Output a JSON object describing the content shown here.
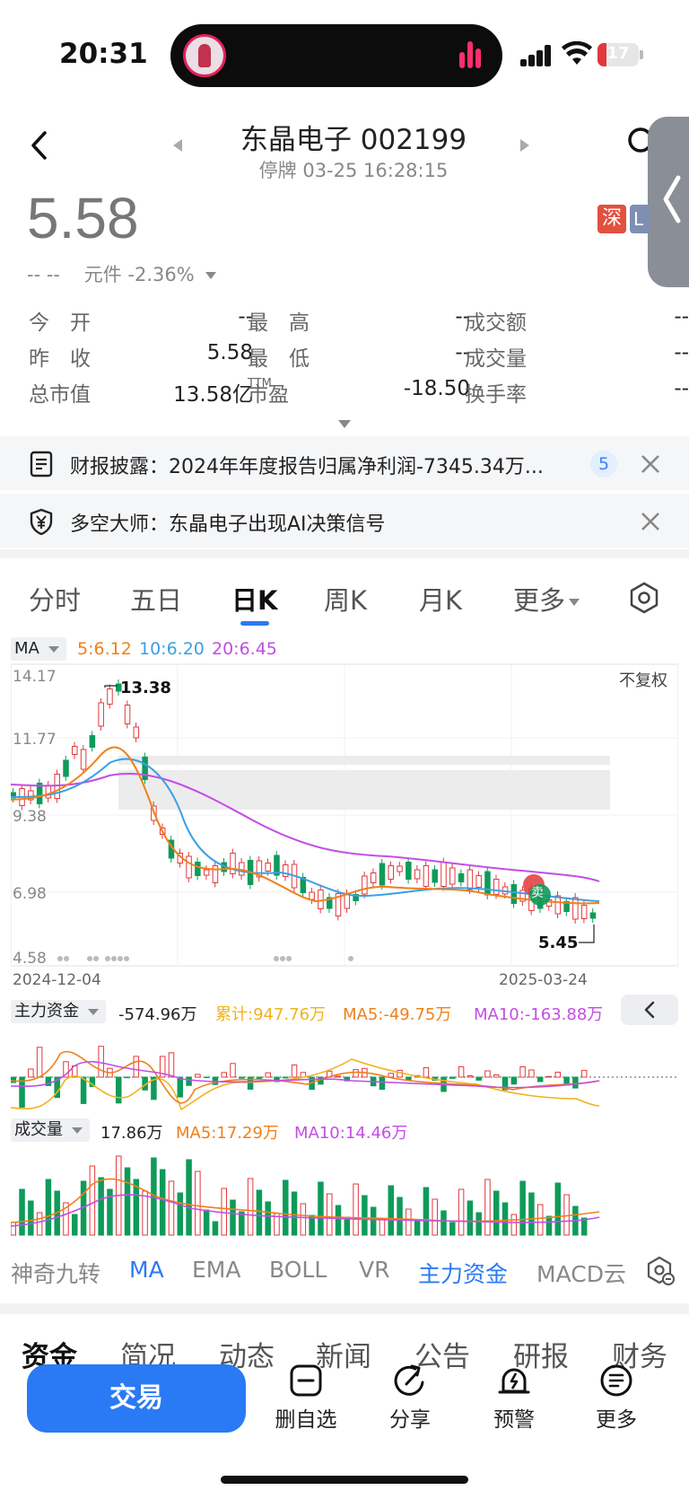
{
  "status_bar": {
    "time": "20:31",
    "battery": "17"
  },
  "header": {
    "title": "东晶电子 002199",
    "subtitle": "停牌 03-25 16:28:15"
  },
  "quote": {
    "price": "5.58",
    "change_prefix": "-- --",
    "unit": "元件",
    "change_pct": "-2.36%",
    "exchange_badge": "深",
    "exchange_badge2": "L"
  },
  "stats": {
    "open_label": "今　开",
    "open_value": "--",
    "high_label": "最　高",
    "high_value": "--",
    "amount_label": "成交额",
    "amount_value": "--",
    "prev_close_label": "昨　收",
    "prev_close_value": "5.58",
    "low_label": "最　低",
    "low_value": "--",
    "volume_label": "成交量",
    "volume_value": "--",
    "mktcap_label": "总市值",
    "mktcap_value": "13.58亿",
    "pe_label": "市盈",
    "pe_sup": "TTM",
    "pe_value": "-18.50",
    "turnover_label": "换手率",
    "turnover_value": "--"
  },
  "notices": [
    {
      "text": "财报披露：2024年年度报告归属净利润-7345.34万...",
      "badge": "5"
    },
    {
      "text": "多空大师：东晶电子出现AI决策信号"
    }
  ],
  "chart_tabs": [
    "分时",
    "五日",
    "日K",
    "周K",
    "月K",
    "更多"
  ],
  "ma_legend": {
    "label": "MA",
    "ma5": "5:6.12",
    "ma10": "10:6.20",
    "ma20": "20:6.45"
  },
  "axis": {
    "y_top": "14.17",
    "y_2": "11.77",
    "y_3": "9.38",
    "y_4": "6.98",
    "y_bottom": "4.58",
    "no_adjust": "不复权",
    "date_start": "2024-12-04",
    "date_end": "2025-03-24",
    "high_marker": "13.38",
    "low_marker": "5.45",
    "sell_label": "卖"
  },
  "fund_flow": {
    "label": "主力资金",
    "value": "-574.96万",
    "cumulative": "累计:947.76万",
    "ma5": "MA5:-49.75万",
    "ma10": "MA10:-163.88万"
  },
  "volume": {
    "label": "成交量",
    "value": "17.86万",
    "ma5": "MA5:17.29万",
    "ma10": "MA10:14.46万"
  },
  "indicator_tabs": [
    "神奇九转",
    "MA",
    "EMA",
    "BOLL",
    "VR",
    "主力资金",
    "MACD云"
  ],
  "bottom_tabs": [
    "资金",
    "简况",
    "动态",
    "新闻",
    "公告",
    "研报",
    "财务"
  ],
  "actions": {
    "trade": "交易",
    "remove_watch": "删自选",
    "share": "分享",
    "alert": "预警",
    "more": "更多"
  },
  "colors": {
    "up": "#e2383b",
    "down": "#0e9b5a",
    "ma5": "#f07f1a",
    "ma10": "#3aa0e6",
    "ma20": "#c44de6",
    "accent": "#2a7af5"
  }
}
